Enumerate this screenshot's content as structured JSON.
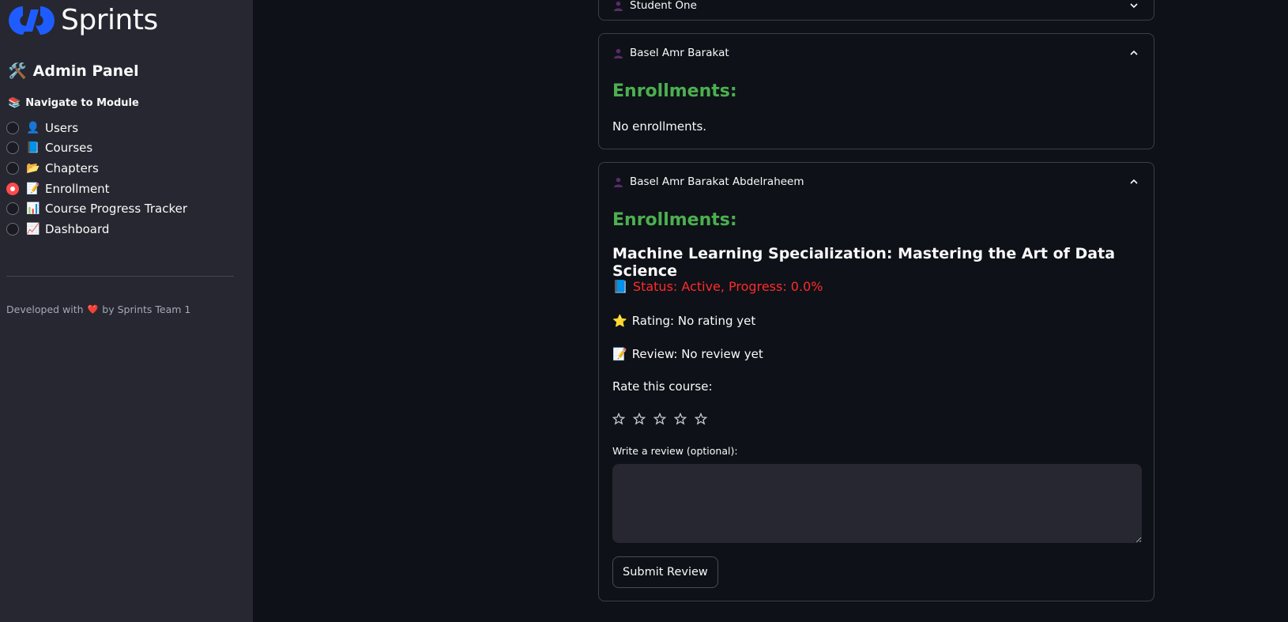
{
  "sidebar": {
    "logo_text": "Sprints",
    "admin_title": "Admin Panel",
    "admin_icon": "🛠️",
    "nav_label": "Navigate to Module",
    "nav_icon": "📚",
    "items": [
      {
        "emoji": "👤",
        "label": "Users",
        "selected": false
      },
      {
        "emoji": "📘",
        "label": "Courses",
        "selected": false
      },
      {
        "emoji": "📂",
        "label": "Chapters",
        "selected": false
      },
      {
        "emoji": "📝",
        "label": "Enrollment",
        "selected": true
      },
      {
        "emoji": "📊",
        "label": "Course Progress Tracker",
        "selected": false
      },
      {
        "emoji": "📈",
        "label": "Dashboard",
        "selected": false
      }
    ],
    "footer_before": "Developed with",
    "footer_heart": "❤️",
    "footer_after": "by Sprints Team 1"
  },
  "panels": {
    "student_one": {
      "name": "Student One"
    },
    "basel": {
      "name": "Basel Amr Barakat",
      "enrollments_heading": "Enrollments:",
      "no_enrollments": "No enrollments."
    },
    "basel_full": {
      "name": "Basel Amr Barakat Abdelraheem",
      "enrollments_heading": "Enrollments:",
      "course_title": "Machine Learning Specialization: Mastering the Art of Data Science",
      "status_icon": "📘",
      "status_text": "Status: Active, Progress: 0.0%",
      "rating_icon": "⭐",
      "rating_text": "Rating: No rating yet",
      "review_icon": "📝",
      "review_text": "Review: No review yet",
      "rate_label": "Rate this course:",
      "star_count": 5,
      "review_field_label": "Write a review (optional):",
      "review_value": "",
      "submit_label": "Submit Review"
    }
  },
  "colors": {
    "accent_red": "#ff4b4b",
    "enroll_green": "#4caf50",
    "status_red": "#ff2b2b",
    "logo_blue": "#1f5cff"
  }
}
